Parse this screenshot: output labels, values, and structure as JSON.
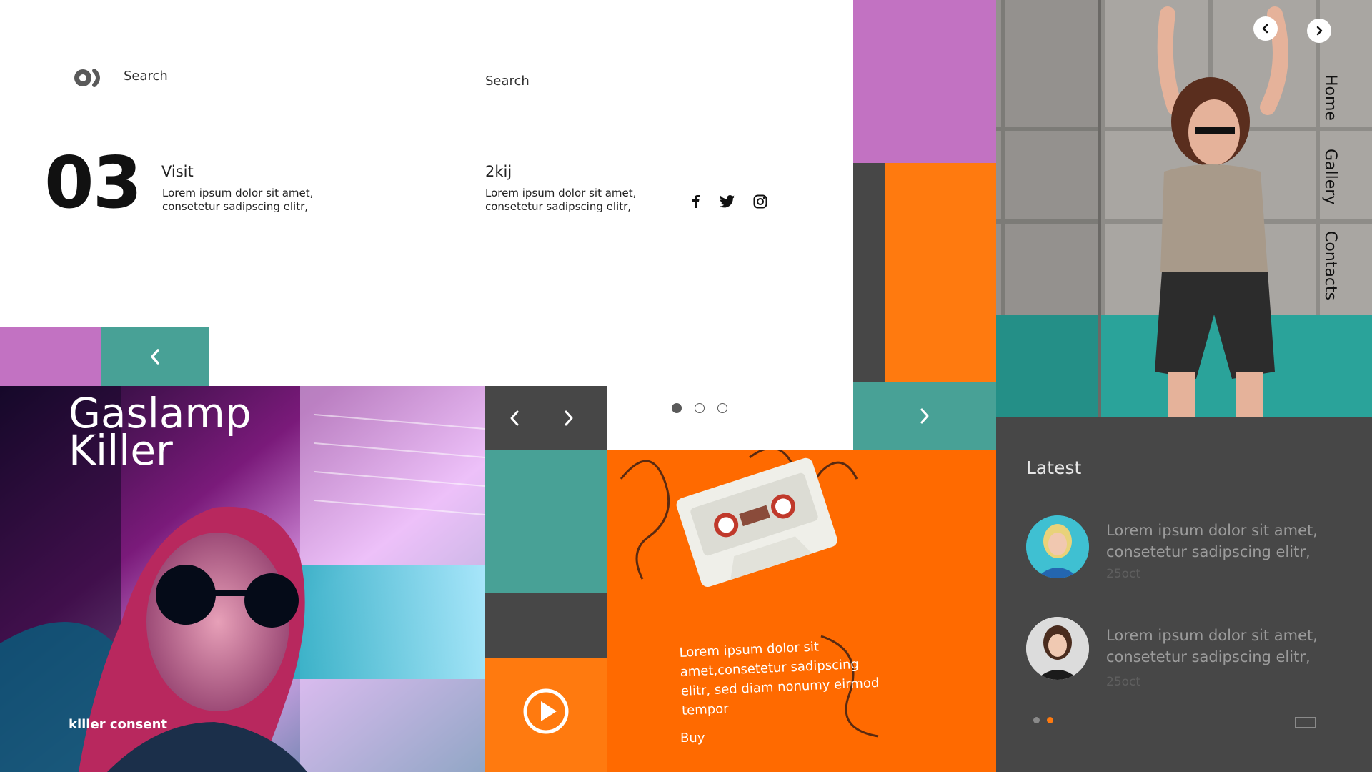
{
  "header": {
    "search_left": "Search",
    "search_right": "Search",
    "logo_icon": "logo-icon"
  },
  "intro": {
    "number": "03",
    "visit_title": "Visit",
    "visit_text": "Lorem ipsum dolor sit amet, consetetur sadipscing elitr,",
    "brand_title": "2kij",
    "brand_text": "Lorem ipsum dolor sit amet, consetetur sadipscing elitr,"
  },
  "social": [
    "facebook-icon",
    "twitter-icon",
    "instagram-icon"
  ],
  "colors": {
    "purple": "#c272c2",
    "teal": "#48a196",
    "orange": "#ff7a0f",
    "dark": "#474747"
  },
  "featured": {
    "title": "Gaslamp Killer",
    "subtitle": "killer consent"
  },
  "slider": {
    "active_index": 0,
    "count": 3
  },
  "product": {
    "description": "Lorem ipsum dolor sit amet,consetetur sadipscing elitr, sed diam nonumy eirmod tempor",
    "buy_label": "Buy"
  },
  "nav": {
    "items": [
      "Home",
      "Gallery",
      "Contacts"
    ]
  },
  "latest": {
    "title": "Latest",
    "items": [
      {
        "text": "Lorem ipsum dolor sit amet, consetetur sadipscing elitr,",
        "date": "25oct"
      },
      {
        "text": "Lorem ipsum dolor sit amet, consetetur sadipscing elitr,",
        "date": "25oct"
      }
    ],
    "pager_active": 1,
    "pager_count": 2
  }
}
